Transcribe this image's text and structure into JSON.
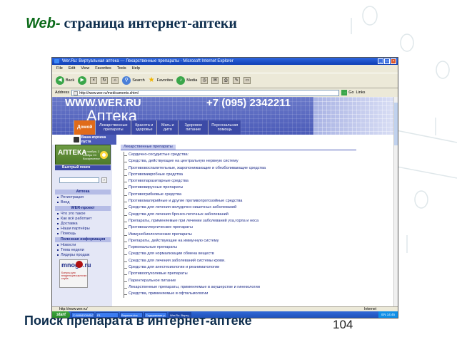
{
  "slide": {
    "title_web": "Web-",
    "title_rest": " страница интернет-аптеки",
    "caption": "Поиск препарата в интернет-аптеке",
    "number": "104"
  },
  "browser": {
    "window_title": "Wer.Ru: Виртуальная аптека — Лекарственные препараты - Microsoft Internet Explorer",
    "menu": [
      "File",
      "Edit",
      "View",
      "Favorites",
      "Tools",
      "Help"
    ],
    "toolbar": {
      "back": "Back",
      "search": "Search",
      "favorites": "Favorites",
      "media": "Media"
    },
    "address_label": "Address",
    "address_value": "http://www.wer.ru/medicaments.shtml",
    "go_label": "Go",
    "links_label": "Links",
    "status_text": "http://www.wer.ru/",
    "status_zone": "Internet"
  },
  "site": {
    "name": "WWW.WER.RU",
    "phone": "+7 (095) 2342211",
    "section_title": "Аптека",
    "nav": [
      {
        "label": "Домой",
        "active": true
      },
      {
        "label": "Лекарственные препараты",
        "active": false
      },
      {
        "label": "Красота и здоровье",
        "active": false
      },
      {
        "label": "Мать и дитя",
        "active": false
      },
      {
        "label": "Здоровое питание",
        "active": false
      },
      {
        "label": "Персональная помощь",
        "active": false
      }
    ],
    "cart_label": "Ваша корзина пуста",
    "logo_text": "АПТЕКА",
    "logo_sub": "24 ноября, 2 ноября 24 Воскресенье",
    "quick_search": "Быстрый поиск",
    "sidebar_sections": [
      {
        "heading": "Аптека",
        "links": [
          "Регистрация",
          "Вход"
        ]
      },
      {
        "heading": "WER-проект",
        "links": [
          "Что это такое",
          "Как всё работает",
          "Доставка",
          "Наши партнёры",
          "Помощь"
        ]
      },
      {
        "heading": "Полезная информация",
        "links": [
          "Новости",
          "Тема недели",
          "Лидеры продаж"
        ]
      }
    ],
    "banner_title": "mnogo.ru",
    "banner_text": "Бонусы для владельцев карточки клуба",
    "content_title": "Лекарственные препараты",
    "categories": [
      "Сердечно-сосудистые средства:",
      "Средства, действующие на центральную нервную систему",
      "Противовоспалительные, жаропонижающие и обезболивающие средства",
      "Противомикробные средства",
      "Противопаразитарные средства",
      "Противовирусные препараты",
      "Противогрибковые средства",
      "Противомалярийные и другие противопротозойные средства",
      "Средства для лечения желудочно-кишечных заболеваний",
      "Средства для лечения бронхо-легочных заболеваний",
      "Препараты, применяемые при лечении заболеваний уха,горла и носа",
      "Противоаллергические препараты",
      "Иммунобиологические препараты",
      "Препараты, действующие на иммунную систему",
      "Гормональные препараты",
      "Средства для нормализации обмена веществ",
      "Средства для лечения заболеваний системы крови.",
      "Средства для анестезиологии и реаниматологии",
      "Противоопухолевые препараты",
      "Парентеральное питание",
      "Лекарственные препараты, применяемые в акушерстве и гинекологии",
      "Средства, применяемые в офтальмологии"
    ]
  },
  "taskbar": {
    "start": "start",
    "items": [
      "C:\\WINDOWS\\CA...",
      "Р1",
      "Вариант.doc",
      "Содержание.р...",
      "Wer.Ru: Вирту..."
    ],
    "tray": "EN  14:45"
  }
}
